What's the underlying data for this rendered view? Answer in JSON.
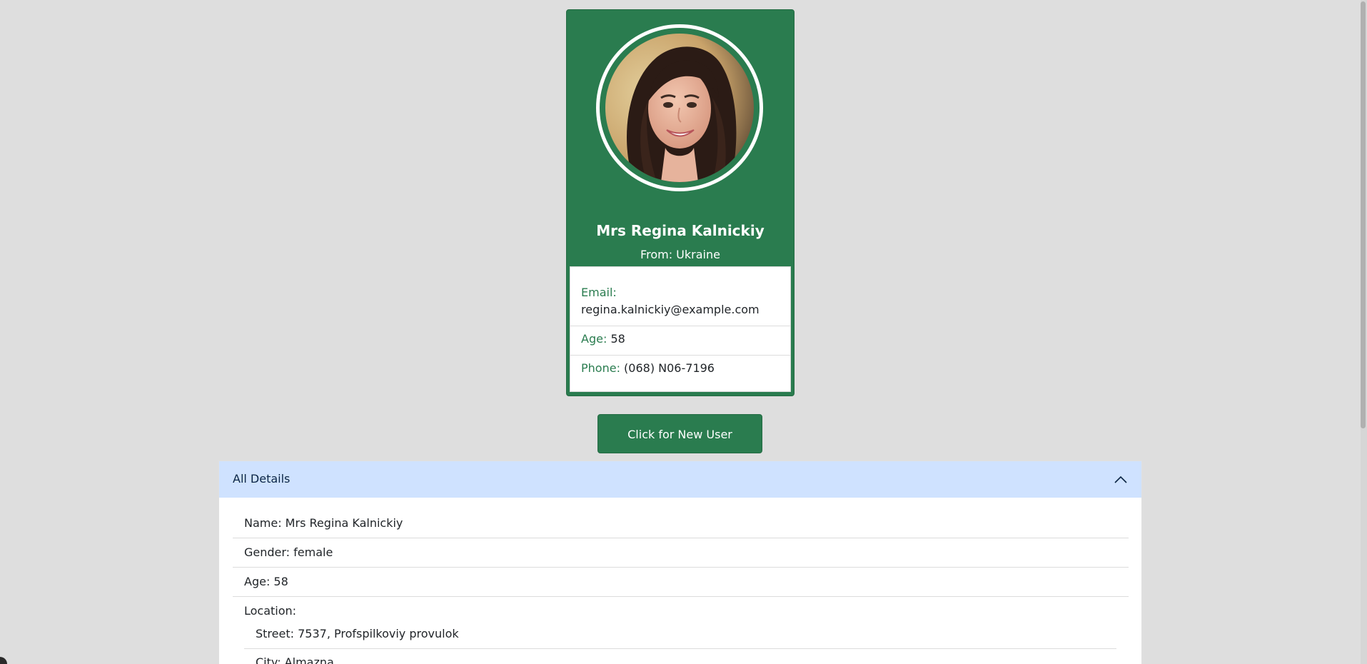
{
  "card": {
    "name": "Mrs Regina Kalnickiy",
    "from": "From: Ukraine",
    "email_label": "Email:",
    "email_value": "regina.kalnickiy@example.com",
    "age_label": "Age:",
    "age_value": "58",
    "phone_label": "Phone:",
    "phone_value": "(068) N06-7196"
  },
  "button": {
    "new_user_label": "Click for New User"
  },
  "details": {
    "title": "All Details",
    "expanded": true,
    "name": "Name: Mrs Regina Kalnickiy",
    "gender": "Gender: female",
    "age": "Age: 58",
    "location_label": "Location:",
    "street": "Street: 7537, Profspilkoviy provulok",
    "city": "City: Almazna"
  },
  "colors": {
    "accent": "#2a7c4f",
    "header_bg": "#cfe2ff",
    "page_bg": "#dedede"
  },
  "icons": {
    "accordion_toggle": "chevron-up-icon"
  }
}
